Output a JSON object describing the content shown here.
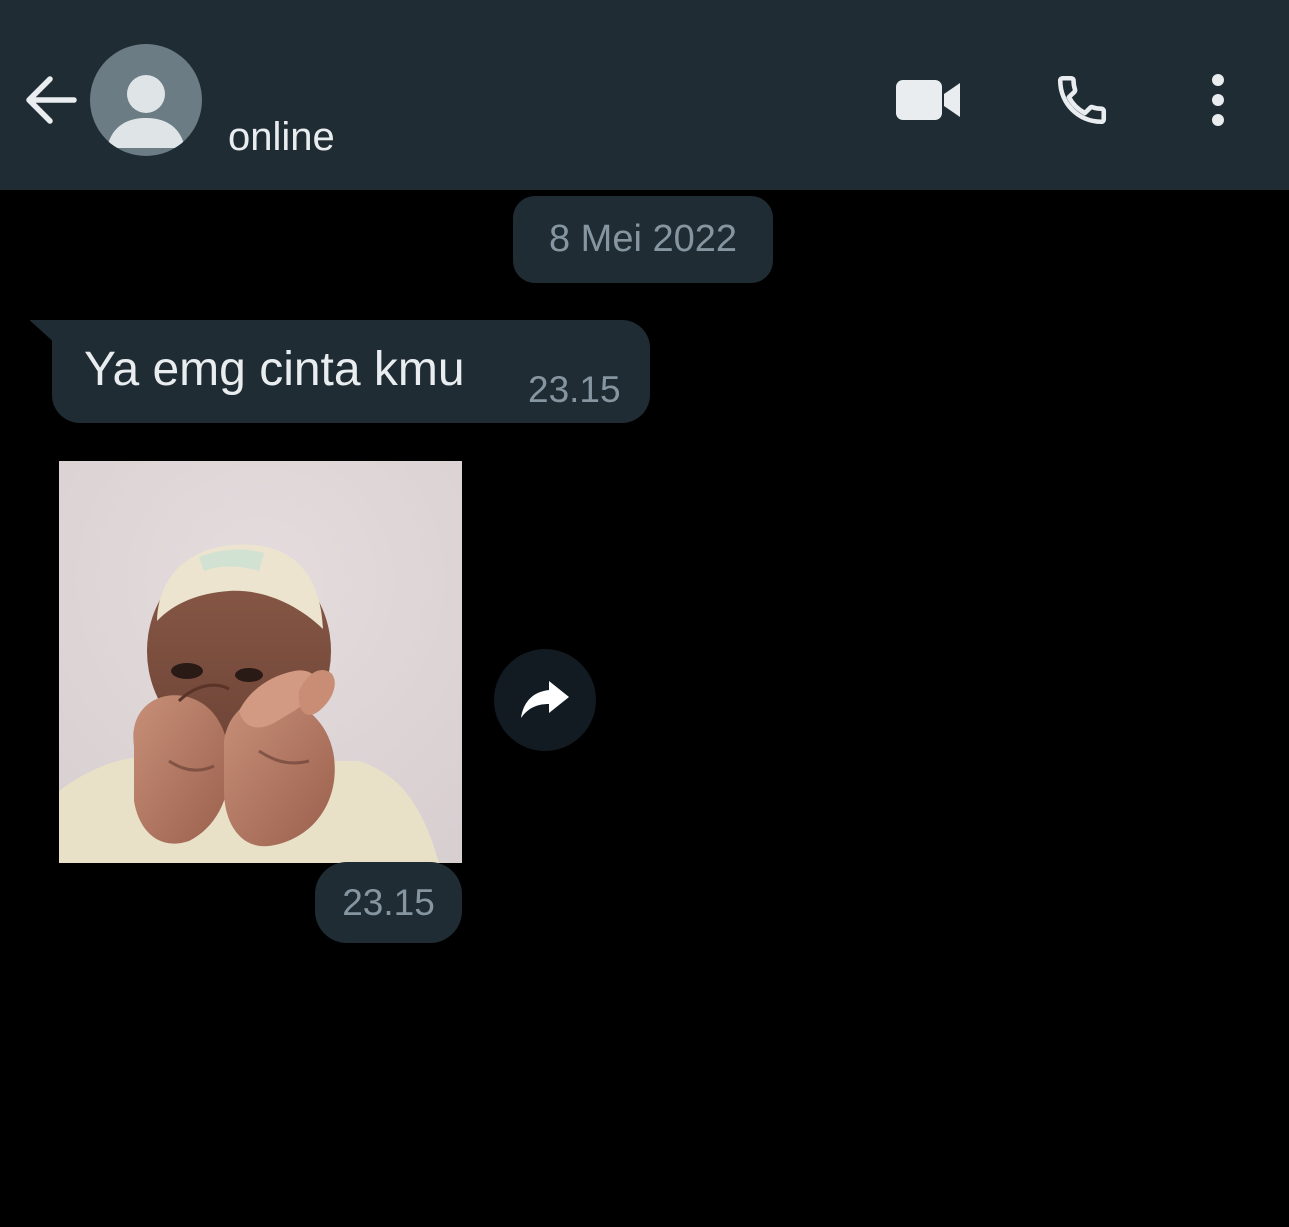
{
  "header": {
    "back_icon": "arrow-left-icon",
    "avatar_icon": "person-placeholder-icon",
    "status": "online",
    "video_icon": "videocam-icon",
    "call_icon": "phone-icon",
    "menu_icon": "more-vertical-icon"
  },
  "chat": {
    "date_label": "8 Mei 2022",
    "messages": [
      {
        "type": "text",
        "direction": "incoming",
        "text": "Ya emg cinta kmu",
        "time": "23.15"
      },
      {
        "type": "sticker",
        "direction": "incoming",
        "forward_icon": "forward-icon",
        "time": "23.15"
      }
    ]
  },
  "colors": {
    "header_bg": "#1f2c34",
    "chat_bg": "#000000",
    "bubble_bg": "#1f2c34",
    "primary_text": "#e9edef",
    "secondary_text": "#8696a0"
  }
}
